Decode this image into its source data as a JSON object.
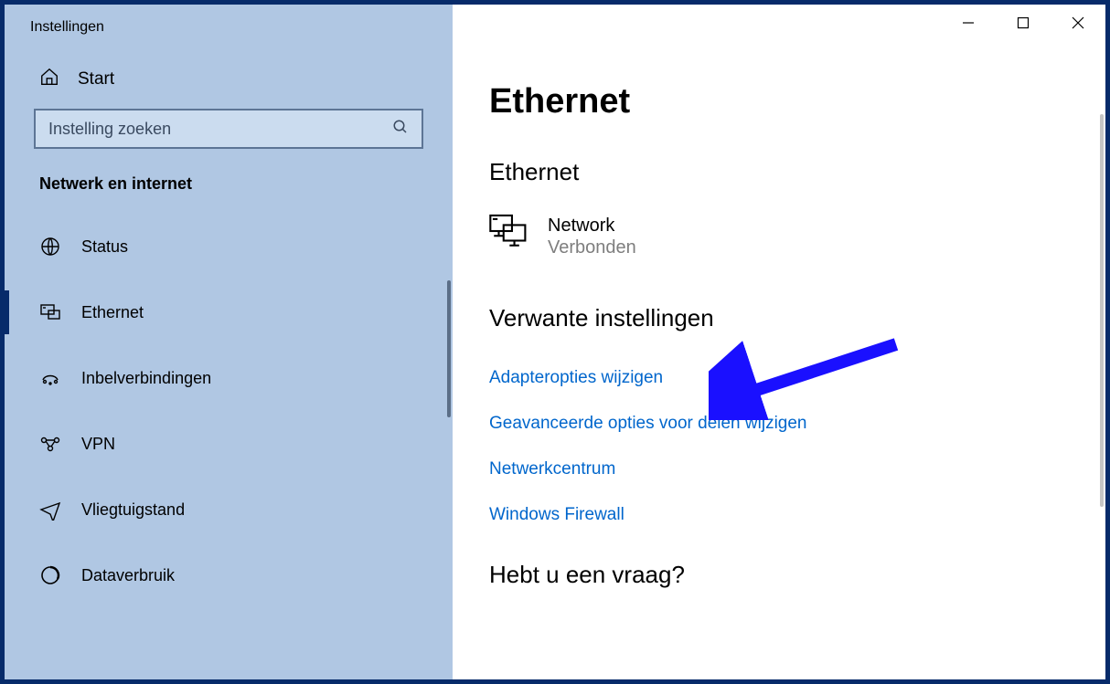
{
  "window": {
    "title": "Instellingen"
  },
  "home": {
    "label": "Start"
  },
  "search": {
    "placeholder": "Instelling zoeken"
  },
  "category": {
    "label": "Netwerk en internet"
  },
  "nav": [
    {
      "label": "Status"
    },
    {
      "label": "Ethernet"
    },
    {
      "label": "Inbelverbindingen"
    },
    {
      "label": "VPN"
    },
    {
      "label": "Vliegtuigstand"
    },
    {
      "label": "Dataverbruik"
    }
  ],
  "page": {
    "title": "Ethernet",
    "section": "Ethernet",
    "network": {
      "name": "Network",
      "status": "Verbonden"
    },
    "related_heading": "Verwante instellingen",
    "links": [
      "Adapteropties wijzigen",
      "Geavanceerde opties voor delen wijzigen",
      "Netwerkcentrum",
      "Windows Firewall"
    ],
    "question": "Hebt u een vraag?"
  }
}
